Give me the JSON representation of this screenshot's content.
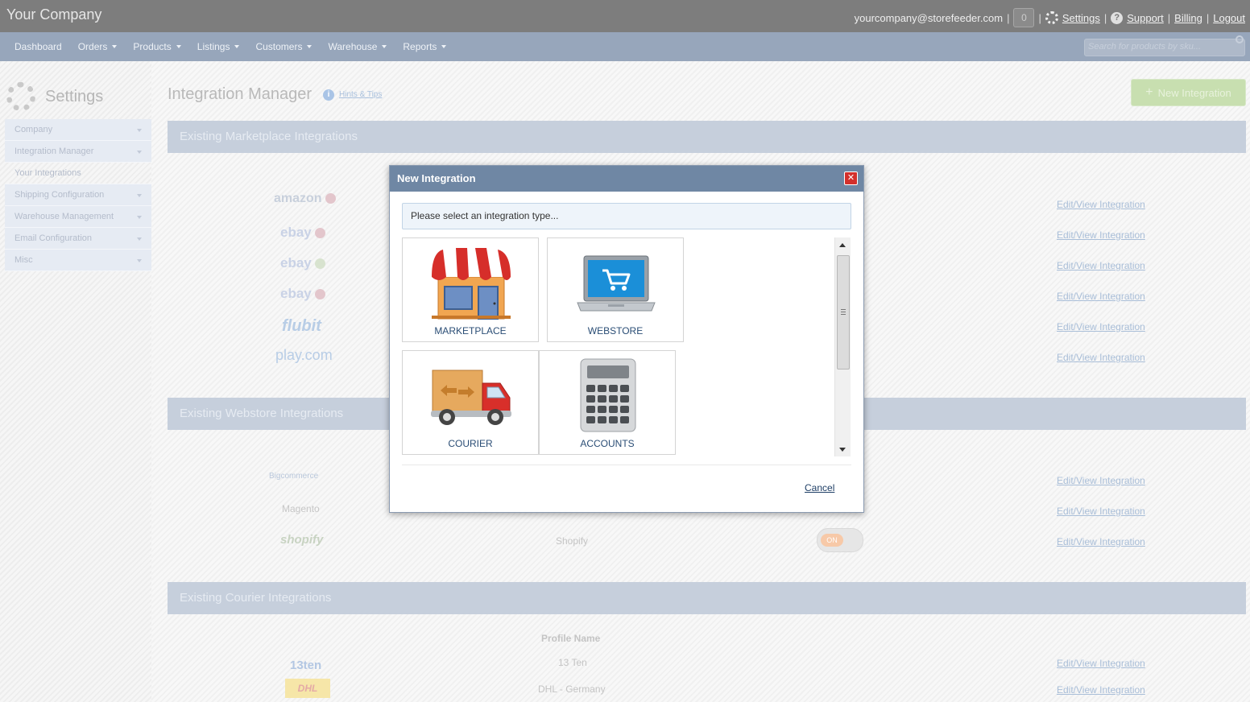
{
  "header": {
    "brand": "Your Company",
    "email": "yourcompany@storefeeder.com",
    "count": "0",
    "links": {
      "settings": "Settings",
      "support": "Support",
      "billing": "Billing",
      "logout": "Logout"
    },
    "separator": "|"
  },
  "nav": {
    "items": [
      {
        "label": "Dashboard",
        "has_menu": false
      },
      {
        "label": "Orders",
        "has_menu": true
      },
      {
        "label": "Products",
        "has_menu": true
      },
      {
        "label": "Listings",
        "has_menu": true
      },
      {
        "label": "Customers",
        "has_menu": true
      },
      {
        "label": "Warehouse",
        "has_menu": true
      },
      {
        "label": "Reports",
        "has_menu": true
      }
    ],
    "search_placeholder": "Search for products by sku..."
  },
  "sidebar": {
    "title": "Settings",
    "items": [
      {
        "label": "Company",
        "has_menu": true
      },
      {
        "label": "Integration Manager",
        "has_menu": true
      },
      {
        "label": "Your Integrations",
        "has_menu": false
      },
      {
        "label": "Shipping Configuration",
        "has_menu": true
      },
      {
        "label": "Warehouse Management",
        "has_menu": true
      },
      {
        "label": "Email Configuration",
        "has_menu": true
      },
      {
        "label": "Misc",
        "has_menu": true
      }
    ]
  },
  "page": {
    "title": "Integration Manager",
    "hints_label": "Hints & Tips",
    "new_integration_label": "New Integration",
    "edit_label": "Edit/View Integration",
    "sections": {
      "marketplace": "Existing Marketplace Integrations",
      "webstore": "Existing Webstore Integrations",
      "courier": "Existing Courier Integrations"
    },
    "marketplace_logos": [
      "amazon",
      "ebay",
      "ebay",
      "ebay",
      "flubit",
      "play.com"
    ],
    "webstore_logos": [
      "Bigcommerce",
      "Magento",
      "shopify"
    ],
    "shopify_name": "Shopify",
    "toggle_label": "ON",
    "courier": {
      "column_header": "Profile Name",
      "rows": [
        {
          "logo": "13ten",
          "name": "13 Ten"
        },
        {
          "logo": "DHL",
          "name": "DHL - Germany"
        }
      ]
    }
  },
  "modal": {
    "title": "New Integration",
    "close_symbol": "✕",
    "prompt": "Please select an integration type...",
    "options": [
      {
        "label": "MARKETPLACE",
        "icon": "storefront-icon"
      },
      {
        "label": "WEBSTORE",
        "icon": "laptop-cart-icon"
      },
      {
        "label": "COURIER",
        "icon": "delivery-truck-icon"
      },
      {
        "label": "ACCOUNTS",
        "icon": "calculator-icon"
      }
    ],
    "cancel_label": "Cancel"
  }
}
